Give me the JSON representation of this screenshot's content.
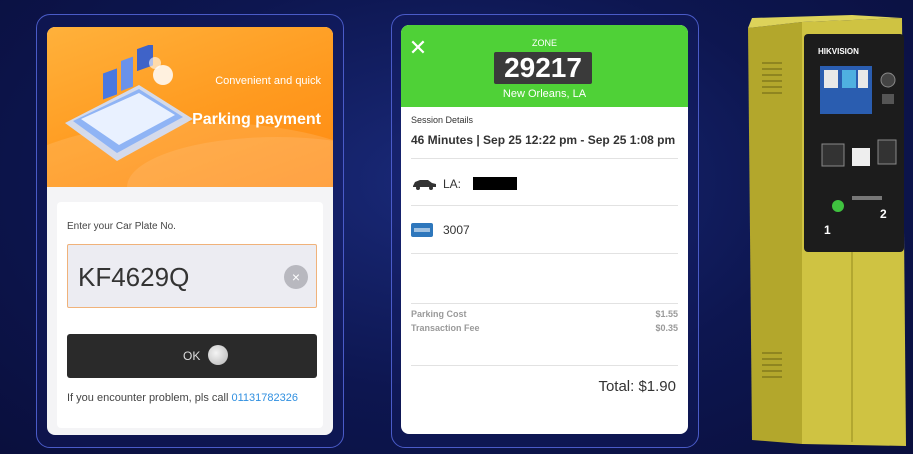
{
  "left_app": {
    "banner": {
      "subtitle": "Convenient and quick",
      "title": "Parking payment"
    },
    "plate_form": {
      "label": "Enter your Car Plate No.",
      "plate_value": "KF4629Q",
      "clear_symbol": "×",
      "ok_label": "OK",
      "help_prefix": "If you encounter problem, pls call",
      "help_phone": "01131782326"
    }
  },
  "middle_app": {
    "close_symbol": "✕",
    "zone_label": "ZONE",
    "zone_number": "29217",
    "city": "New Orleans, LA",
    "session_label": "Session Details",
    "session_time": "46 Minutes | Sep 25 12:22 pm - Sep 25 1:08 pm",
    "vehicle_prefix": "LA:",
    "card_last4": "3007",
    "parking_cost_label": "Parking Cost",
    "parking_cost_value": "$1.55",
    "transaction_fee_label": "Transaction Fee",
    "transaction_fee_value": "$0.35",
    "total": "Total: $1.90"
  },
  "kiosk": {
    "brand": "HIKVISION"
  },
  "colors": {
    "background": "#0d1650",
    "banner_orange": "#ff9a1f",
    "zone_green": "#4fd137",
    "kiosk_yellow": "#c9bd3a",
    "link_blue": "#2f8fe0"
  }
}
